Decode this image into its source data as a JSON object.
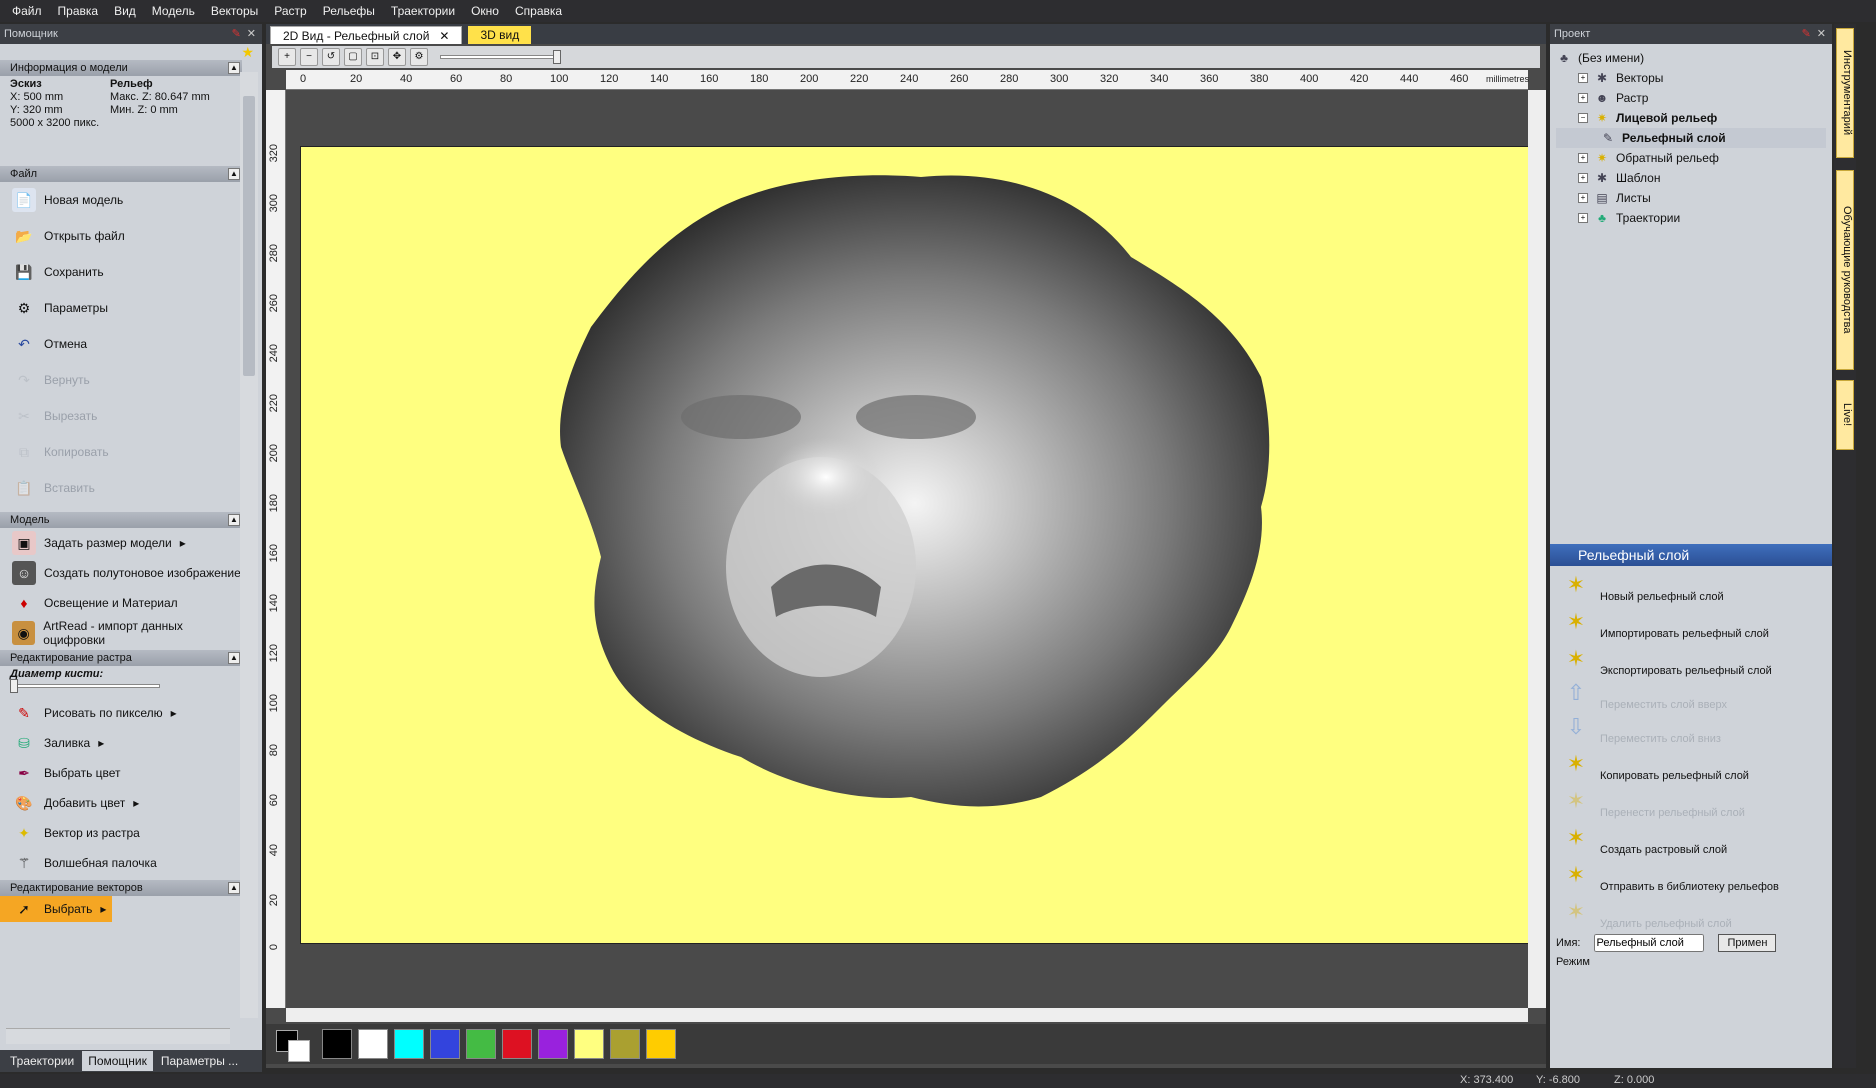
{
  "menu": [
    "Файл",
    "Правка",
    "Вид",
    "Модель",
    "Векторы",
    "Растр",
    "Рельефы",
    "Траектории",
    "Окно",
    "Справка"
  ],
  "left_panel": {
    "title": "Помощник",
    "info_section": "Информация о модели",
    "info": {
      "sketch_label": "Эскиз",
      "relief_label": "Рельеф",
      "x": "X: 500 mm",
      "y": "Y: 320 mm",
      "pixels": "5000 x 3200 пикс.",
      "max_z": "Макс. Z: 80.647 mm",
      "min_z": "Мин. Z: 0 mm"
    },
    "file_section": "Файл",
    "file_items": [
      {
        "label": "Новая модель",
        "enabled": true
      },
      {
        "label": "Открыть файл",
        "enabled": true
      },
      {
        "label": "Сохранить",
        "enabled": true
      },
      {
        "label": "Параметры",
        "enabled": true
      },
      {
        "label": "Отмена",
        "enabled": true
      },
      {
        "label": "Вернуть",
        "enabled": false
      },
      {
        "label": "Вырезать",
        "enabled": false
      },
      {
        "label": "Копировать",
        "enabled": false
      },
      {
        "label": "Вставить",
        "enabled": false
      }
    ],
    "model_section": "Модель",
    "model_items": [
      {
        "label": "Задать размер модели"
      },
      {
        "label": "Создать полутоновое изображение"
      },
      {
        "label": "Освещение и Материал"
      },
      {
        "label": "ArtRead - импорт данных оцифровки"
      }
    ],
    "raster_section": "Редактирование растра",
    "brush_label": "Диаметр кисти:",
    "raster_items": [
      {
        "label": "Рисовать по пикселю"
      },
      {
        "label": "Заливка"
      },
      {
        "label": "Выбрать цвет"
      },
      {
        "label": "Добавить цвет"
      },
      {
        "label": "Вектор из растра"
      },
      {
        "label": "Волшебная палочка"
      }
    ],
    "vector_section": "Редактирование векторов",
    "vector_items": [
      {
        "label": "Выбрать"
      }
    ],
    "bottom_tabs": [
      "Траектории",
      "Помощник",
      "Параметры ..."
    ]
  },
  "center": {
    "tab_2d": "2D Вид - Рельефный слой",
    "tab_3d": "3D вид",
    "ruler_h": [
      "0",
      "20",
      "40",
      "60",
      "80",
      "100",
      "120",
      "140",
      "160",
      "180",
      "200",
      "220",
      "240",
      "260",
      "280",
      "300",
      "320",
      "340",
      "360",
      "380",
      "400",
      "420",
      "440",
      "460"
    ],
    "ruler_unit": "millimetres",
    "ruler_v": [
      "320",
      "300",
      "280",
      "260",
      "240",
      "220",
      "200",
      "180",
      "160",
      "140",
      "120",
      "100",
      "80",
      "60",
      "40",
      "20",
      "0"
    ],
    "palette": [
      "#000000",
      "#ffffff",
      "#00ffff",
      "#3344dd",
      "#44bb44",
      "#dd1122",
      "#9922dd",
      "#ffff80",
      "#aaa030",
      "#ffcc00"
    ],
    "model_bg": "#ffff80"
  },
  "right_panel": {
    "title": "Проект",
    "tree": [
      {
        "label": "(Без имени)",
        "bold": false,
        "level": 0
      },
      {
        "label": "Векторы",
        "bold": false,
        "level": 1
      },
      {
        "label": "Растр",
        "bold": false,
        "level": 1
      },
      {
        "label": "Лицевой рельеф",
        "bold": true,
        "level": 1
      },
      {
        "label": "Рельефный слой",
        "bold": true,
        "level": 2
      },
      {
        "label": "Обратный рельеф",
        "bold": false,
        "level": 1
      },
      {
        "label": "Шаблон",
        "bold": false,
        "level": 1
      },
      {
        "label": "Листы",
        "bold": false,
        "level": 1
      },
      {
        "label": "Траектории",
        "bold": false,
        "level": 1
      }
    ],
    "relief_header": "Рельефный слой",
    "relief_items": [
      {
        "label": "Новый рельефный слой",
        "enabled": true
      },
      {
        "label": "Импортировать рельефный слой",
        "enabled": true
      },
      {
        "label": "Экспортировать рельефный слой",
        "enabled": true
      },
      {
        "label": "Переместить слой вверх",
        "enabled": false
      },
      {
        "label": "Переместить слой вниз",
        "enabled": false
      },
      {
        "label": "Копировать рельефный слой",
        "enabled": true
      },
      {
        "label": "Перенести рельефный слой",
        "enabled": false
      },
      {
        "label": "Создать растровый слой",
        "enabled": true
      },
      {
        "label": "Отправить в библиотеку рельефов",
        "enabled": true
      },
      {
        "label": "Удалить рельефный слой",
        "enabled": false
      }
    ],
    "name_label": "Имя:",
    "name_value": "Рельефный слой",
    "apply_label": "Примен",
    "mode_label": "Режим"
  },
  "side_tabs": [
    "Инструментарий",
    "Обучающие руководства",
    "Live!"
  ],
  "status": {
    "x": "X: 373.400",
    "y": "Y: -6.800",
    "z": "Z: 0.000"
  }
}
